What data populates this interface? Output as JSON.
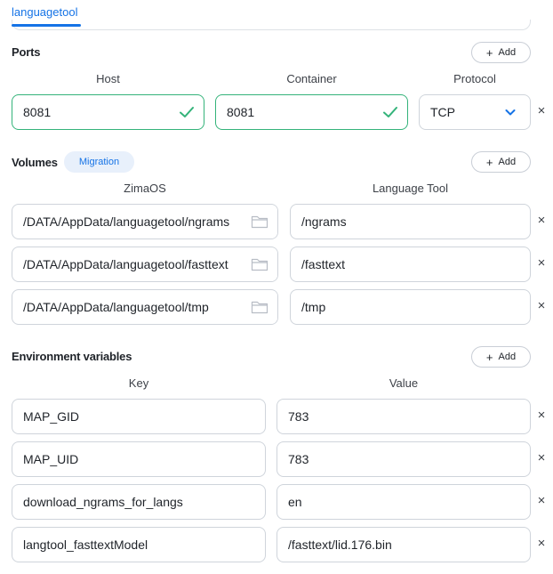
{
  "tabs": [
    {
      "label": "languagetool"
    }
  ],
  "ports": {
    "title": "Ports",
    "add_label": "Add",
    "columns": {
      "host": "Host",
      "container": "Container",
      "protocol": "Protocol"
    },
    "rows": [
      {
        "host": "8081",
        "container": "8081",
        "protocol": "TCP"
      }
    ]
  },
  "volumes": {
    "title": "Volumes",
    "badge": "Migration",
    "add_label": "Add",
    "columns": {
      "host": "ZimaOS",
      "container": "Language Tool"
    },
    "rows": [
      {
        "host": "/DATA/AppData/languagetool/ngrams",
        "container": "/ngrams"
      },
      {
        "host": "/DATA/AppData/languagetool/fasttext",
        "container": "/fasttext"
      },
      {
        "host": "/DATA/AppData/languagetool/tmp",
        "container": "/tmp"
      }
    ]
  },
  "env": {
    "title": "Environment variables",
    "add_label": "Add",
    "columns": {
      "key": "Key",
      "value": "Value"
    },
    "rows": [
      {
        "key": "MAP_GID",
        "value": "783"
      },
      {
        "key": "MAP_UID",
        "value": "783"
      },
      {
        "key": "download_ngrams_for_langs",
        "value": "en"
      },
      {
        "key": "langtool_fasttextModel",
        "value": "/fasttext/lid.176.bin"
      }
    ]
  },
  "remove_glyph": "×",
  "colors": {
    "accent": "#1573e6",
    "valid": "#34b37a",
    "border": "#cfd4db"
  },
  "icons": {
    "valid": "check-icon",
    "select": "chevron-down-icon",
    "browse": "folder-icon",
    "remove": "close-icon",
    "add": "plus-icon"
  }
}
